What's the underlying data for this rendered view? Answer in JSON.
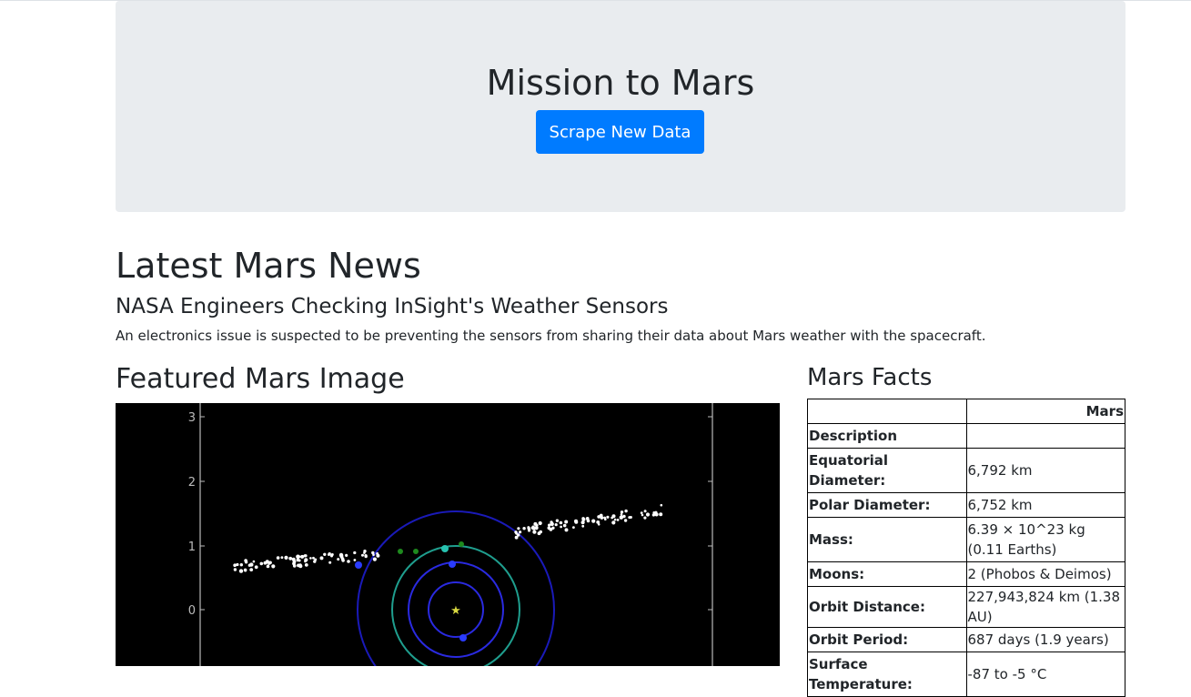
{
  "jumbotron": {
    "title": "Mission to Mars",
    "button_label": "Scrape New Data"
  },
  "news": {
    "heading": "Latest Mars News",
    "title": "NASA Engineers Checking InSight's Weather Sensors",
    "paragraph": "An electronics issue is suspected to be preventing the sensors from sharing their data about Mars weather with the spacecraft."
  },
  "featured": {
    "heading": "Featured Mars Image",
    "y_ticks": [
      "3",
      "2",
      "1",
      "0"
    ]
  },
  "facts": {
    "heading": "Mars Facts",
    "column_header": "Mars",
    "rows": [
      {
        "label": "Description",
        "value": ""
      },
      {
        "label": "Equatorial Diameter:",
        "value": "6,792 km"
      },
      {
        "label": "Polar Diameter:",
        "value": "6,752 km"
      },
      {
        "label": "Mass:",
        "value": "6.39 × 10^23 kg (0.11 Earths)"
      },
      {
        "label": "Moons:",
        "value": "2 (Phobos & Deimos)"
      },
      {
        "label": "Orbit Distance:",
        "value": "227,943,824 km (1.38 AU)"
      },
      {
        "label": "Orbit Period:",
        "value": "687 days (1.9 years)"
      },
      {
        "label": "Surface Temperature:",
        "value": "-87 to -5 °C"
      }
    ]
  },
  "colors": {
    "primary": "#007bff",
    "jumbotron_bg": "#e9ecef",
    "text": "#212529"
  }
}
